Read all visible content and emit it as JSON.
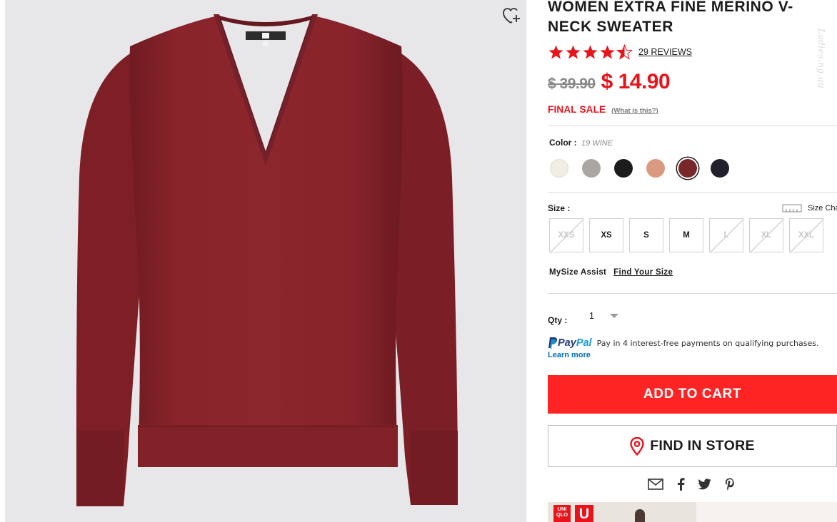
{
  "product": {
    "title": "WOMEN EXTRA FINE MERINO V-NECK SWEATER",
    "rating": 4.5,
    "reviews_label": "29 REVIEWS",
    "original_price": "$ 39.90",
    "sale_price": "$ 14.90",
    "final_sale_label": "FINAL SALE",
    "what_is_this_label": "(What is this?)"
  },
  "image": {
    "background_color": "#e7e7ea",
    "sweater_color": "#87232a",
    "wishlist_icon": "heart-plus-icon"
  },
  "color": {
    "label": "Color :",
    "selected_name": "19 WINE",
    "swatches": [
      {
        "name": "off-white",
        "hex": "#f1ede2",
        "selected": false
      },
      {
        "name": "gray",
        "hex": "#aaa6a3",
        "selected": false
      },
      {
        "name": "black",
        "hex": "#1c1c1c",
        "selected": false
      },
      {
        "name": "pink",
        "hex": "#d99a7f",
        "selected": false
      },
      {
        "name": "wine",
        "hex": "#7a272a",
        "selected": true
      },
      {
        "name": "navy",
        "hex": "#20212d",
        "selected": false
      }
    ]
  },
  "size": {
    "label": "Size :",
    "chart_label": "Size Cha",
    "options": [
      {
        "label": "XXS",
        "available": false
      },
      {
        "label": "XS",
        "available": true
      },
      {
        "label": "S",
        "available": true
      },
      {
        "label": "M",
        "available": true
      },
      {
        "label": "L",
        "available": false
      },
      {
        "label": "XL",
        "available": false
      },
      {
        "label": "XXL",
        "available": false
      }
    ]
  },
  "mysize": {
    "label": "MySize Assist",
    "link": "Find Your Size"
  },
  "quantity": {
    "label": "Qty :",
    "value": "1"
  },
  "paypal": {
    "logo_pay": "Pay",
    "logo_pal": "Pal",
    "message": "Pay in 4 interest-free payments on qualifying purchases.",
    "learn_more": "Learn more"
  },
  "actions": {
    "add_to_cart": "ADD TO CART",
    "find_in_store": "FIND IN STORE"
  },
  "share": [
    "email-icon",
    "facebook-icon",
    "twitter-icon",
    "pinterest-icon"
  ],
  "banner": {
    "logo_text": "UNI QLO",
    "u_logo": "U"
  },
  "watermark": "Ladies.ng.uu",
  "colors": {
    "accent_red": "#fe2424",
    "price_red": "#e8141c",
    "paypal_blue": "#0070ba"
  }
}
